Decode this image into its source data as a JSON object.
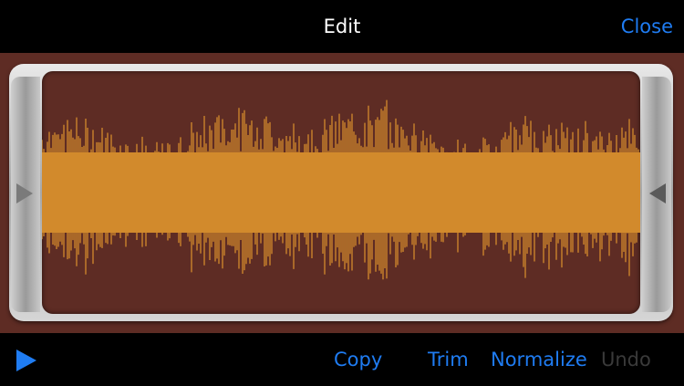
{
  "header": {
    "title": "Edit",
    "close_label": "Close"
  },
  "toolbar": {
    "play_icon": "play-icon",
    "copy_label": "Copy",
    "trim_label": "Trim",
    "normalize_label": "Normalize",
    "undo_label": "Undo"
  },
  "colors": {
    "accent": "#1f7cf2",
    "waveform": "#d28a2c",
    "background": "#5e2c24",
    "disabled": "#3a3a3a"
  }
}
